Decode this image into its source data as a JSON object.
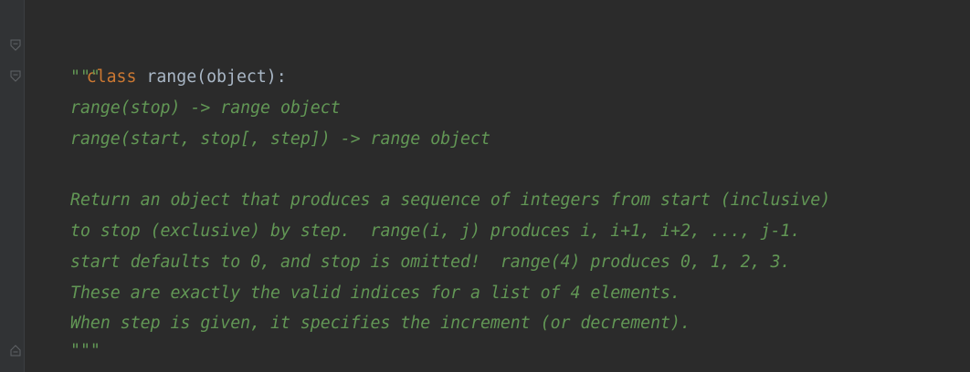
{
  "editor": {
    "class_header": {
      "keyword": "class",
      "signature": " range(object):"
    },
    "docstring": {
      "open_quotes": "\"\"\"",
      "lines": [
        "range(stop) -> range object",
        "range(start, stop[, step]) -> range object",
        "",
        "Return an object that produces a sequence of integers from start (inclusive)",
        "to stop (exclusive) by step.  range(i, j) produces i, i+1, i+2, ..., j-1.",
        "start defaults to 0, and stop is omitted!  range(4) produces 0, 1, 2, 3.",
        "These are exactly the valid indices for a list of 4 elements.",
        "When step is given, it specifies the increment (or decrement)."
      ],
      "close_quotes": "\"\"\""
    }
  },
  "gutter": {
    "fold_icons": [
      "fold-collapse-icon",
      "fold-collapse-icon",
      "fold-end-icon"
    ]
  },
  "colors": {
    "background": "#2b2b2b",
    "gutter": "#313335",
    "keyword": "#cc7832",
    "identifier": "#a9b7c6",
    "docstring": "#629755"
  }
}
